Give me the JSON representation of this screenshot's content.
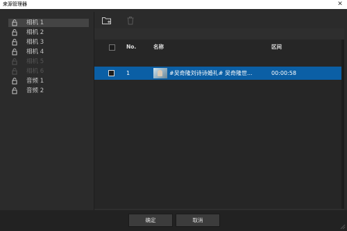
{
  "window": {
    "title": "来源管理器",
    "close_symbol": "✕"
  },
  "sidebar": {
    "items": [
      {
        "label": "相机 1",
        "selected": true,
        "disabled": false
      },
      {
        "label": "相机 2",
        "selected": false,
        "disabled": false
      },
      {
        "label": "相机 3",
        "selected": false,
        "disabled": false
      },
      {
        "label": "相机 4",
        "selected": false,
        "disabled": false
      },
      {
        "label": "相机 5",
        "selected": false,
        "disabled": true
      },
      {
        "label": "相机 6",
        "selected": false,
        "disabled": true
      },
      {
        "label": "音频 1",
        "selected": false,
        "disabled": false
      },
      {
        "label": "音频 2",
        "selected": false,
        "disabled": false
      }
    ]
  },
  "toolbar": {
    "add_icon": "add-folder-icon",
    "delete_icon": "trash-icon"
  },
  "table": {
    "headers": {
      "no": "No.",
      "name": "名称",
      "range": "区间"
    },
    "rows": [
      {
        "no": "1",
        "name": "#吴奇隆刘诗诗婚礼# 吴奇隆世...",
        "range": "00:00:58",
        "selected": true
      }
    ]
  },
  "footer": {
    "ok_label": "确定",
    "cancel_label": "取消"
  },
  "colors": {
    "accent": "#0b5fa5",
    "background": "#2b2b2b"
  }
}
